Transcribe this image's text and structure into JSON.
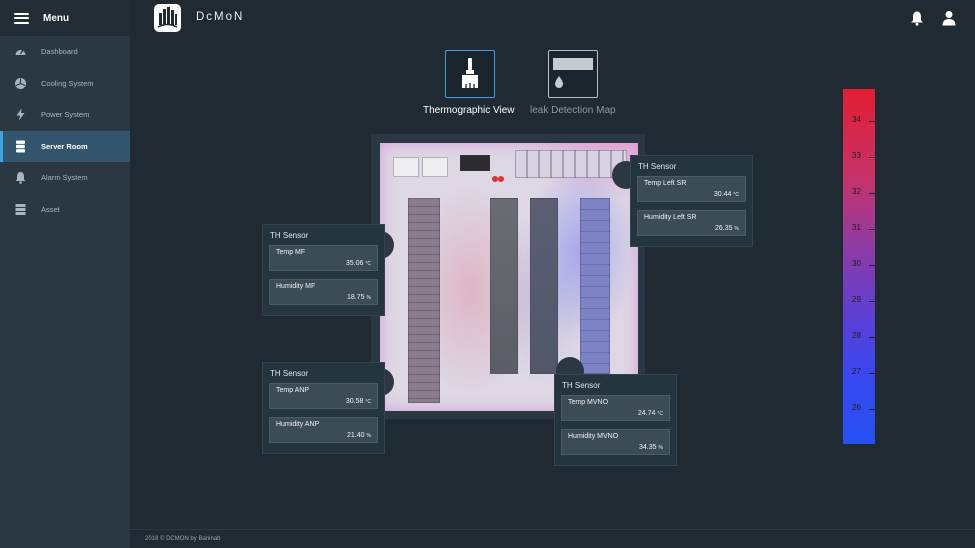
{
  "sidebar": {
    "title": "Menu",
    "items": [
      {
        "label": "Dashboard",
        "icon": "gauge-icon"
      },
      {
        "label": "Cooling System",
        "icon": "fan-icon"
      },
      {
        "label": "Power System",
        "icon": "lightning-icon"
      },
      {
        "label": "Server Room",
        "icon": "server-icon",
        "active": true
      },
      {
        "label": "Alarm System",
        "icon": "bell-icon"
      },
      {
        "label": "Asset",
        "icon": "database-icon"
      }
    ]
  },
  "header": {
    "brand": "DcMoN"
  },
  "views": {
    "thermographic": {
      "label": "Thermographic View",
      "icon": "brush-icon",
      "active": true
    },
    "leak": {
      "label": "leak Detection Map",
      "icon": "drop-icon",
      "active": false
    }
  },
  "sensors": {
    "mf": {
      "title": "TH Sensor",
      "temp_label": "Temp MF",
      "temp_value": "35.06",
      "temp_unit": "°C",
      "hum_label": "Humidity MF",
      "hum_value": "18.75",
      "hum_unit": "%"
    },
    "sr": {
      "title": "TH Sensor",
      "temp_label": "Temp Left SR",
      "temp_value": "30.44",
      "temp_unit": "°C",
      "hum_label": "Humidity Left SR",
      "hum_value": "26.35",
      "hum_unit": "%"
    },
    "anp": {
      "title": "TH Sensor",
      "temp_label": "Temp ANP",
      "temp_value": "30.58",
      "temp_unit": "°C",
      "hum_label": "Humidity ANP",
      "hum_value": "21.40",
      "hum_unit": "%"
    },
    "mvno": {
      "title": "TH Sensor",
      "temp_label": "Temp MVNO",
      "temp_value": "24.74",
      "temp_unit": "°C",
      "hum_label": "Humidity MVNO",
      "hum_value": "34.35",
      "hum_unit": "%"
    }
  },
  "scale": {
    "ticks": [
      "34",
      "33",
      "32",
      "31",
      "30",
      "29",
      "28",
      "27",
      "26"
    ],
    "colors": {
      "hot": "#e41d32",
      "mid": "#8d3ba6",
      "cold": "#2551f3"
    }
  },
  "footer": {
    "text": "2018 © DCMON by Baninab"
  },
  "colors": {
    "accent": "#3aa6e6",
    "sidebar": "#2b3741",
    "background": "#1f2a33"
  }
}
